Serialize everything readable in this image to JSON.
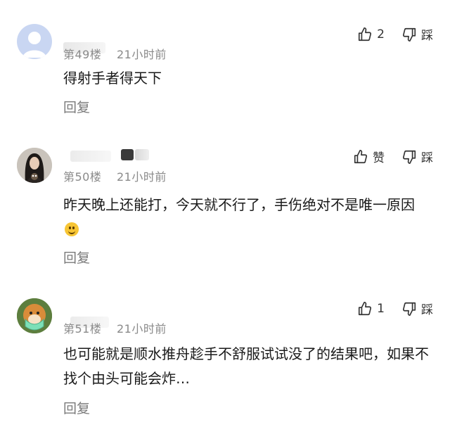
{
  "comments": [
    {
      "floor": "第49楼",
      "time": "21小时前",
      "content": "得射手者得天下",
      "reply_label": "回复",
      "like_label": "2",
      "dislike_label": "踩"
    },
    {
      "floor": "第50楼",
      "time": "21小时前",
      "content": "昨天晚上还能打，今天就不行了，手伤绝对不是唯一原因",
      "reply_label": "回复",
      "like_label": "赞",
      "dislike_label": "踩"
    },
    {
      "floor": "第51楼",
      "time": "21小时前",
      "content": "也可能就是顺水推舟趁手不舒服试试没了的结果吧，如果不找个由头可能会炸…",
      "reply_label": "回复",
      "like_label": "1",
      "dislike_label": "踩"
    }
  ],
  "icons": {
    "like": "thumbs-up-icon",
    "dislike": "thumbs-down-icon",
    "emoji": "smile-emoji-icon"
  }
}
